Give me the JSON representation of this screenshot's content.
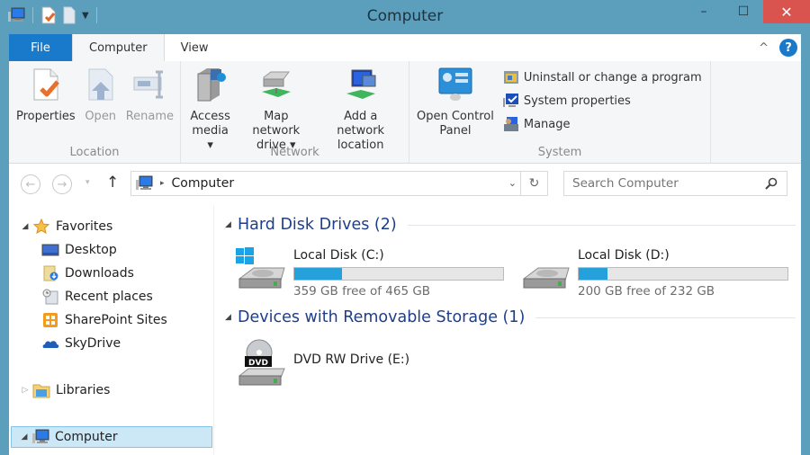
{
  "window": {
    "title": "Computer",
    "controls": {
      "minimize": "–",
      "maximize": "☐",
      "close": "✕"
    }
  },
  "quick_access": {
    "icons": [
      "computer-icon",
      "properties-icon",
      "new-folder-icon",
      "customize-dropdown-icon"
    ]
  },
  "tabs": [
    {
      "label": "File"
    },
    {
      "label": "Computer"
    },
    {
      "label": "View"
    }
  ],
  "ribbon": {
    "groups": [
      {
        "label": "Location",
        "buttons": [
          {
            "label": "Properties",
            "enabled": true
          },
          {
            "label": "Open",
            "enabled": false
          },
          {
            "label": "Rename",
            "enabled": false
          }
        ]
      },
      {
        "label": "Network",
        "buttons": [
          {
            "line1": "Access",
            "line2": "media ▾"
          },
          {
            "line1": "Map network",
            "line2": "drive ▾"
          },
          {
            "line1": "Add a network",
            "line2": "location"
          }
        ]
      },
      {
        "label": "System",
        "big_button": {
          "line1": "Open Control",
          "line2": "Panel"
        },
        "small_buttons": [
          {
            "label": "Uninstall or change a program"
          },
          {
            "label": "System properties"
          },
          {
            "label": "Manage"
          }
        ]
      }
    ],
    "collapse_glyph": "^",
    "help_glyph": "?"
  },
  "navigation": {
    "back_glyph": "←",
    "forward_glyph": "→",
    "recent_glyph": "▾",
    "up_glyph": "↑",
    "breadcrumb": [
      "Computer"
    ],
    "breadcrumb_sep": "▸",
    "dropdown_glyph": "⌄",
    "refresh_glyph": "↻",
    "search_placeholder": "Search Computer"
  },
  "nav_pane": {
    "favorites": {
      "label": "Favorites",
      "expanded_glyph": "◢",
      "items": [
        {
          "label": "Desktop"
        },
        {
          "label": "Downloads"
        },
        {
          "label": "Recent places"
        },
        {
          "label": "SharePoint Sites"
        },
        {
          "label": "SkyDrive"
        }
      ]
    },
    "libraries": {
      "label": "Libraries",
      "collapsed_glyph": "▷"
    },
    "computer": {
      "label": "Computer",
      "expanded_glyph": "◢",
      "selected": true
    }
  },
  "content": {
    "sections": [
      {
        "title": "Hard Disk Drives (2)",
        "drives": [
          {
            "name": "Local Disk (C:)",
            "free": "359 GB free of 465 GB",
            "used_fraction": 0.228
          },
          {
            "name": "Local Disk (D:)",
            "free": "200 GB free of 232 GB",
            "used_fraction": 0.138
          }
        ]
      },
      {
        "title": "Devices with Removable Storage (1)",
        "drives": [
          {
            "name": "DVD RW Drive (E:)",
            "badge": "DVD"
          }
        ]
      }
    ]
  },
  "colors": {
    "frame": "#5b9fbd",
    "file_tab": "#1979ca",
    "close_button": "#d9534f",
    "section_title": "#1e3e8c",
    "usage_bar": "#26a0da",
    "selection": "#cce8f7"
  }
}
